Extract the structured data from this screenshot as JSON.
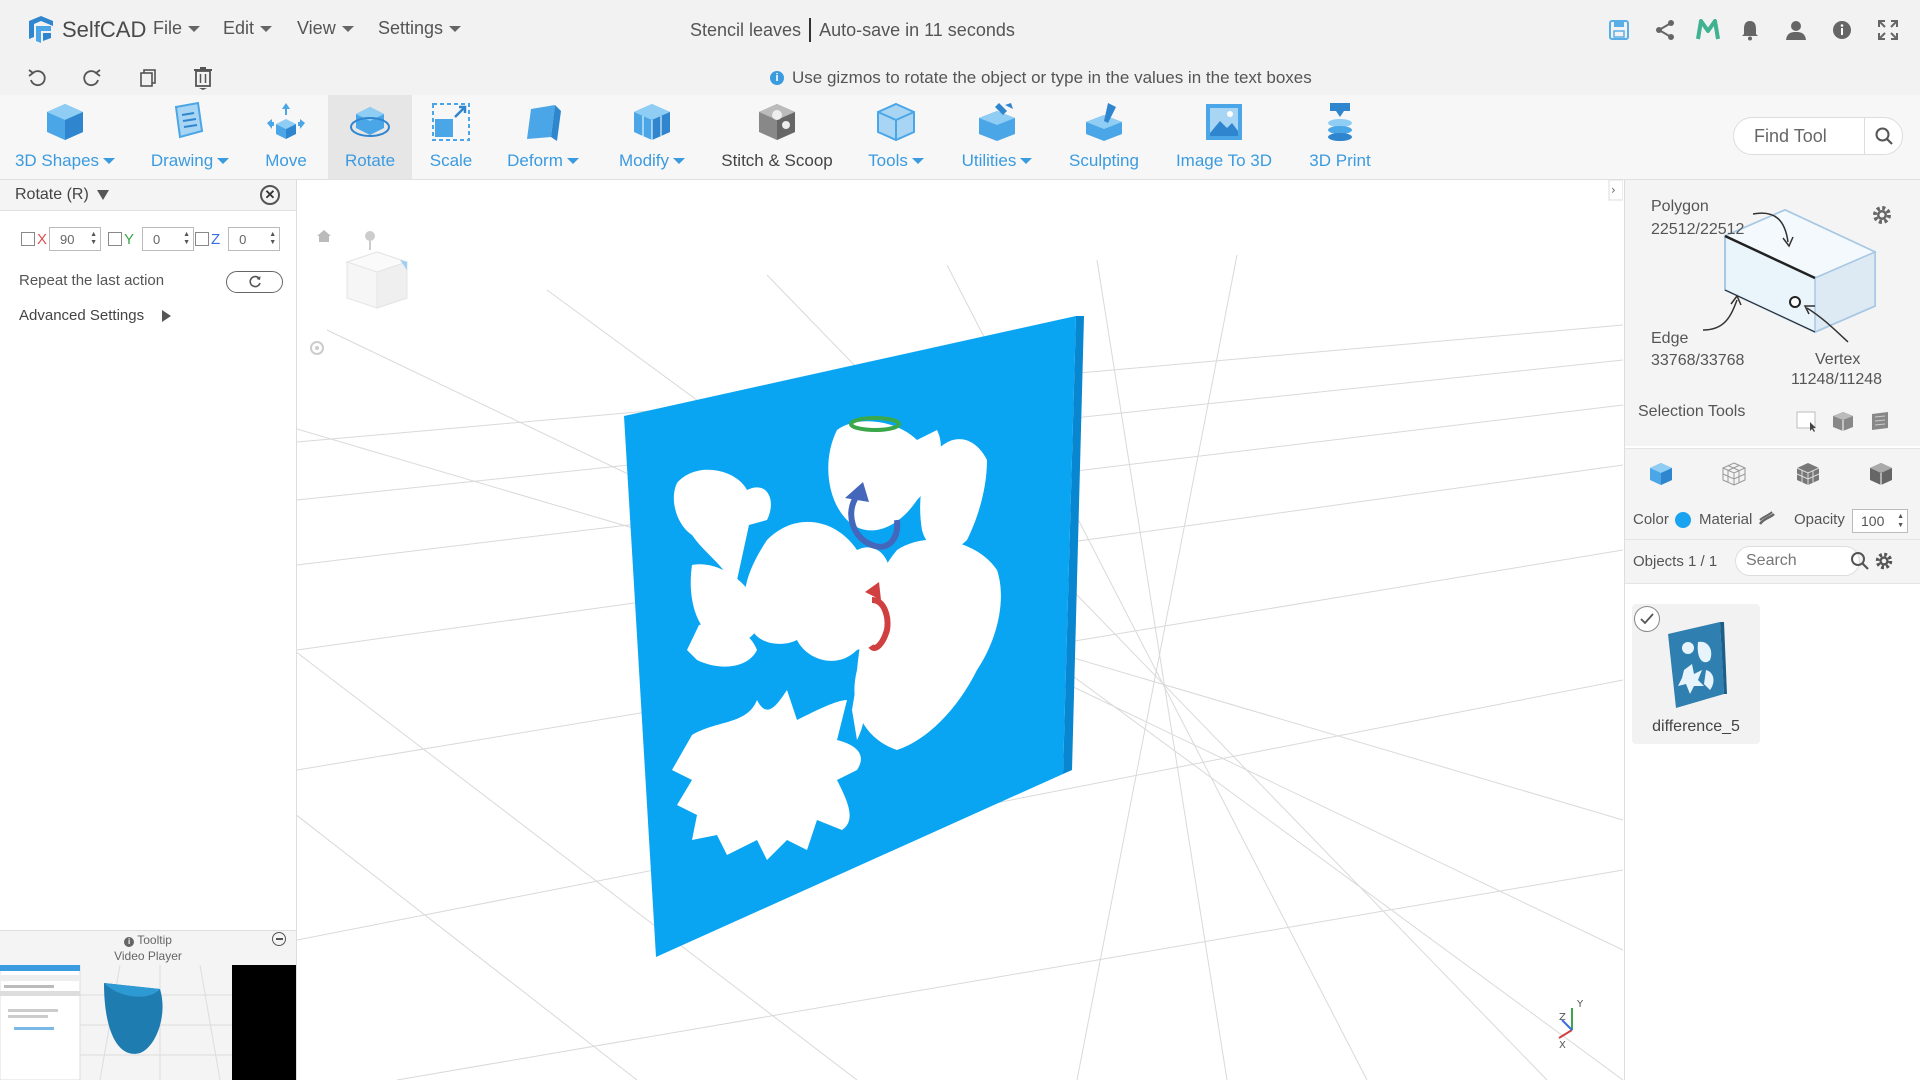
{
  "app": {
    "name": "SelfCAD",
    "brand_color": "#3a9be0"
  },
  "menu": [
    {
      "label": "File"
    },
    {
      "label": "Edit"
    },
    {
      "label": "View"
    },
    {
      "label": "Settings"
    }
  ],
  "document": {
    "title": "Stencil leaves",
    "autosave": "Auto-save in 11 seconds"
  },
  "top_icons": [
    "save-icon",
    "share-icon",
    "m-icon",
    "bell-icon",
    "user-icon",
    "info-icon",
    "fullscreen-icon"
  ],
  "hint": {
    "text": "Use gizmos to rotate the object or type in the values in the text boxes"
  },
  "toolbar": {
    "tools": [
      {
        "label": "3D Shapes",
        "dropdown": true
      },
      {
        "label": "Drawing",
        "dropdown": true
      },
      {
        "label": "Move",
        "dropdown": false
      },
      {
        "label": "Rotate",
        "dropdown": false,
        "active": true
      },
      {
        "label": "Scale",
        "dropdown": false
      },
      {
        "label": "Deform",
        "dropdown": true
      },
      {
        "label": "Modify",
        "dropdown": true
      },
      {
        "label": "Stitch & Scoop",
        "dropdown": false
      },
      {
        "label": "Tools",
        "dropdown": true
      },
      {
        "label": "Utilities",
        "dropdown": true
      },
      {
        "label": "Sculpting",
        "dropdown": false
      },
      {
        "label": "Image To 3D",
        "dropdown": false
      },
      {
        "label": "3D Print",
        "dropdown": false
      }
    ],
    "find_placeholder": "Find Tool"
  },
  "rotate_panel": {
    "title": "Rotate (R)",
    "axes": [
      {
        "label": "X",
        "value": "90",
        "checked": false
      },
      {
        "label": "Y",
        "value": "0",
        "checked": false
      },
      {
        "label": "Z",
        "value": "0",
        "checked": false
      }
    ],
    "repeat_label": "Repeat the last action",
    "advanced_label": "Advanced Settings"
  },
  "tooltip": {
    "title": "Tooltip",
    "subtitle": "Video Player"
  },
  "right_panel": {
    "polygon_label": "Polygon",
    "polygon_count": "22512/22512",
    "edge_label": "Edge",
    "edge_count": "33768/33768",
    "vertex_label": "Vertex",
    "vertex_count": "11248/11248",
    "selection_tools_label": "Selection Tools",
    "color_label": "Color",
    "color_value": "#1aa3f0",
    "material_label": "Material",
    "opacity_label": "Opacity",
    "opacity_value": "100",
    "objects_label": "Objects 1 / 1",
    "search_placeholder": "Search",
    "objects": [
      {
        "name": "difference_5",
        "selected": true
      }
    ]
  },
  "scene": {
    "object_color": "#0aa5f2",
    "axis_labels": [
      "Y",
      "X",
      "Z"
    ]
  }
}
